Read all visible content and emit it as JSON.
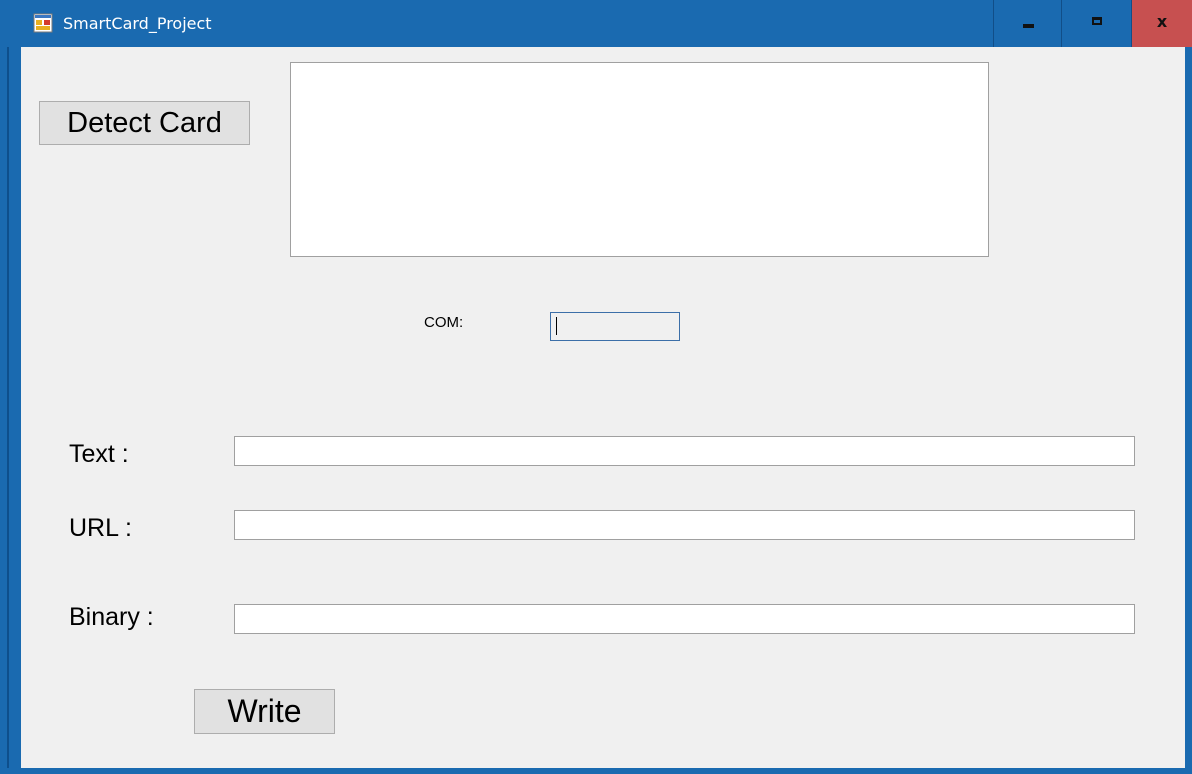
{
  "window": {
    "title": "SmartCard_Project",
    "app_icon": "winforms-app-icon",
    "controls": {
      "minimize_icon": "minimize-icon",
      "maximize_icon": "maximize-icon",
      "close_label": "x"
    },
    "colors": {
      "titlebar": "#1a6ab0",
      "close_button": "#c75050",
      "client_background": "#f0f0f0"
    }
  },
  "main": {
    "detect_button_label": "Detect Card",
    "output_text": "",
    "com": {
      "label": "COM:",
      "value": ""
    },
    "fields": {
      "text_label": "Text :",
      "text_value": "",
      "url_label": "URL :",
      "url_value": "",
      "binary_label": "Binary :",
      "binary_value": ""
    },
    "write_button_label": "Write"
  }
}
